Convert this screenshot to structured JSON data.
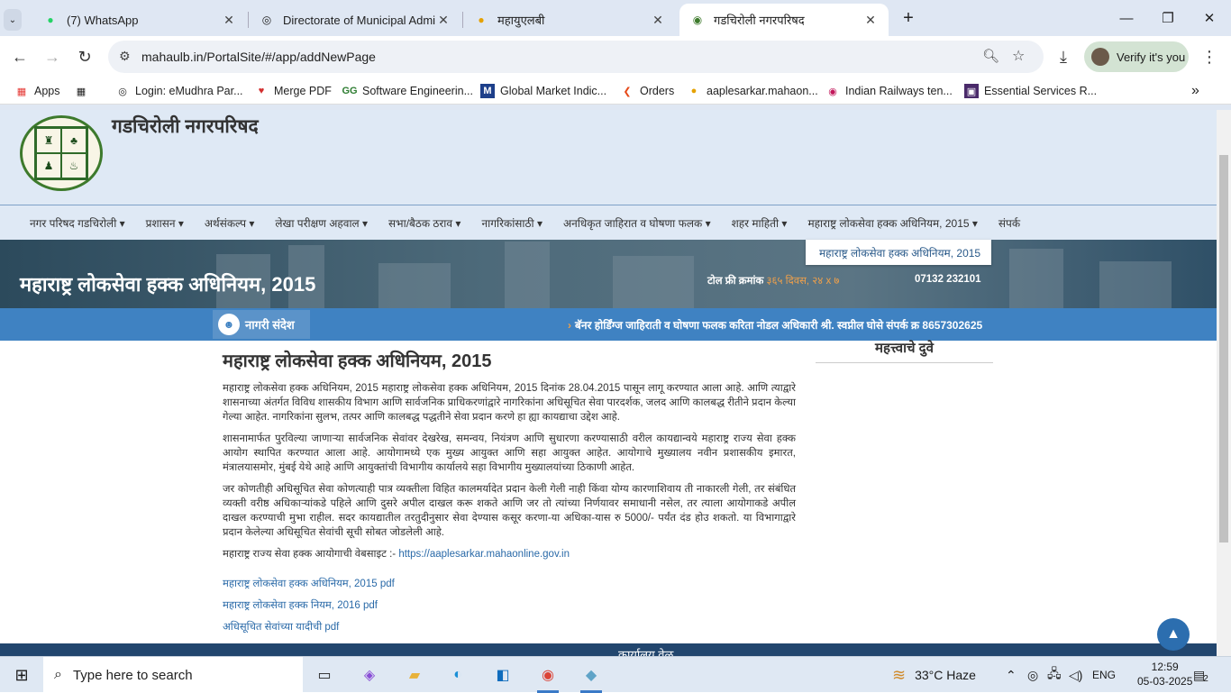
{
  "browser": {
    "tabs": [
      {
        "title": "(7) WhatsApp",
        "icon": "whatsapp-icon"
      },
      {
        "title": "Directorate of Municipal Admin",
        "icon": "globe-icon"
      },
      {
        "title": "महायुएलबी",
        "icon": "site-icon"
      },
      {
        "title": "गडचिरोली नगरपरिषद",
        "icon": "site-icon",
        "active": true
      }
    ],
    "url": "mahaulb.in/PortalSite/#/app/addNewPage",
    "verify_label": "Verify it's you",
    "bookmarks": [
      "Apps",
      "Login: eMudhra Par...",
      "Merge PDF",
      "Software Engineerin...",
      "Global Market Indic...",
      "Orders",
      "aaplesarkar.mahaon...",
      "Indian Railways ten...",
      "Essential Services R..."
    ]
  },
  "site": {
    "title": "गडचिरोली नगरपरिषद",
    "nav": [
      "नगर परिषद गडचिरोली",
      "प्रशासन",
      "अर्थसंकल्प",
      "लेखा परीक्षण अहवाल",
      "सभा/बैठक ठराव",
      "नागरिकांसाठी",
      "अनधिकृत जाहिरात व घोषणा फलक",
      "शहर माहिती",
      "महाराष्ट्र लोकसेवा हक्क अधिनियम, 2015",
      "संपर्क"
    ],
    "dropdown_item": "महाराष्ट्र लोकसेवा हक्क अधिनियम, 2015",
    "banner_title": "महाराष्ट्र लोकसेवा हक्क अधिनियम, 2015",
    "toll_label": "टोल फ्री क्रमांक",
    "toll_hours": "३६५ दिवस, २४ x ७",
    "phone": "07132 232101",
    "notice_label": "नागरी संदेश",
    "notice_text": "बॅनर होर्डिंग्ज जाहिराती व घोषणा फलक करिता नोडल अधिकारी श्री. स्वप्नील घोसे संपर्क क्र 8657302625"
  },
  "content": {
    "heading": "महाराष्ट्र लोकसेवा हक्क अधिनियम, 2015",
    "p1": "महाराष्ट्र लोकसेवा हक्क अधिनियम, 2015 महाराष्ट्र लोकसेवा हक्क अधिनियम, 2015 दिनांक 28.04.2015 पासून लागू करण्यात आला आहे. आणि त्याद्वारे शासनाच्या अंतर्गत विविध शासकीय विभाग आणि सार्वजनिक प्राधिकरणांद्वारे नागरिकांना अधिसूचित सेवा पारदर्शक, जलद आणि कालबद्ध रीतीने प्रदान केल्या गेल्या आहेत. नागरिकांना सुलभ, तत्पर आणि कालबद्ध पद्धतीने सेवा प्रदान करणे हा ह्या कायद्याचा उद्देश आहे.",
    "p2": "शासनामार्फत पुरविल्या जाणाऱ्या सार्वजनिक सेवांवर देखरेख, समन्वय, नियंत्रण आणि सुधारणा करण्यासाठी वरील कायद्यान्वये महाराष्ट्र राज्य सेवा हक्क आयोग स्थापित करण्यात आला आहे. आयोगामध्ये एक मुख्य आयुक्त आणि सहा आयुक्त आहेत. आयोगाचे मुख्यालय नवीन प्रशासकीय इमारत, मंत्रालयासमोर, मुंबई येथे आहे आणि आयुक्तांची विभागीय कार्यालये सहा विभागीय मुख्यालयांच्या ठिकाणी आहेत.",
    "p3": "जर कोणतीही अधिसूचित सेवा कोणत्याही पात्र व्यक्तीला विहित कालमर्यादेत प्रदान केली गेली नाही किंवा योग्य कारणाशिवाय ती नाकारली गेली, तर संबंधित व्यक्ती वरीष्ठ अधिकाऱ्यांकडे पहिले आणि दुसरे अपील दाखल करू शकते आणि जर तो त्यांच्या निर्णयावर समाधानी नसेल, तर त्याला आयोगाकडे अपील दाखल करण्याची मुभा राहील. सदर कायद्यातील तरतुदीनुसार सेवा देण्यास कसूर करणा-या अधिका-यास रु 5000/- पर्यंत दंड होउ शकतो. या विभागाद्वारे प्रदान केलेल्या अधिसूचित सेवांची सूची सोबत जोडलेली आहे.",
    "website_label": "महाराष्ट्र राज्य सेवा हक्क आयोगाची वेबसाइट :-",
    "website_link": "https://aaplesarkar.mahaonline.gov.in",
    "pdfs": [
      "महाराष्ट्र लोकसेवा हक्क अधिनियम, 2015 pdf",
      "महाराष्ट्र लोकसेवा हक्क नियम, 2016 pdf",
      "अधिसूचित सेवांच्या यादीची pdf"
    ],
    "sidebar_title": "महत्त्वाचे दुवे",
    "footer_peek": "कार्यालय वेळ"
  },
  "taskbar": {
    "search_placeholder": "Type here to search",
    "weather": "33°C  Haze",
    "lang": "ENG",
    "time": "12:59",
    "date": "05-03-2025",
    "notifications": "2"
  },
  "colors": {
    "chrome_bg": "#dfe7f3",
    "header_bg": "#dfe9f5",
    "notice_bar": "#3f82c2",
    "link": "#2a6aa8"
  }
}
